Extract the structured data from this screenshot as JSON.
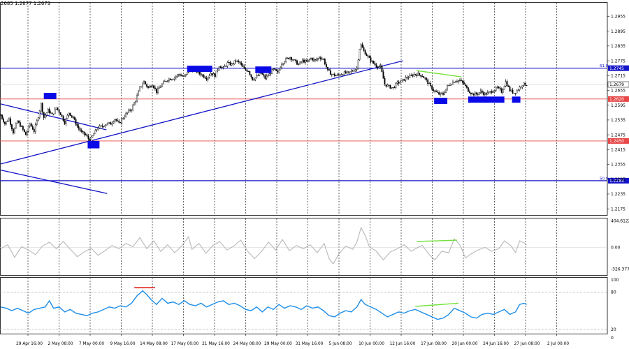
{
  "quote_line": "2685 1.2677 1.2679",
  "chart_data": [
    {
      "type": "candlestick",
      "panel": "price",
      "ylim": [
        1.215,
        1.301
      ],
      "y_ticks": [
        "1.2955",
        "1.2895",
        "1.2835",
        "1.2775",
        "1.2715",
        "1.2655",
        "1.2595",
        "1.2535",
        "1.2475",
        "1.2415",
        "1.2355",
        "1.2295",
        "1.2235",
        "1.2175"
      ],
      "current_price": "1.2679",
      "horizontal_levels": [
        {
          "label": "1.2745",
          "value": 1.2745,
          "fib_label": "61.8",
          "color": "#1414c8"
        },
        {
          "label": "1.2620",
          "value": 1.262,
          "fib_label": "",
          "color": "#e84848"
        },
        {
          "label": "1.2450",
          "value": 1.245,
          "fib_label": "",
          "color": "#e84848"
        },
        {
          "label": "1.2289",
          "value": 1.2289,
          "fib_label": "50.0",
          "color": "#1414c8"
        }
      ],
      "x_ticks": [
        "29 Apr 16:00",
        "2 May 08:00",
        "7 May 00:00",
        "9 May 16:00",
        "14 May 08:00",
        "17 May 00:00",
        "21 May 16:00",
        "24 May 08:00",
        "29 May 00:00",
        "31 May 16:00",
        "5 Jun 08:00",
        "10 Jun 00:00",
        "12 Jun 16:00",
        "17 Jun 08:00",
        "20 Jun 00:00",
        "24 Jun 16:00",
        "27 Jun 08:00",
        "2 Jul 00:00"
      ],
      "close_path": [
        [
          0,
          1.2555
        ],
        [
          6,
          1.252
        ],
        [
          12,
          1.254
        ],
        [
          18,
          1.2485
        ],
        [
          24,
          1.253
        ],
        [
          30,
          1.2505
        ],
        [
          36,
          1.2475
        ],
        [
          42,
          1.252
        ],
        [
          48,
          1.249
        ],
        [
          54,
          1.255
        ],
        [
          58,
          1.26
        ],
        [
          62,
          1.2545
        ],
        [
          68,
          1.2575
        ],
        [
          74,
          1.2555
        ],
        [
          80,
          1.2585
        ],
        [
          86,
          1.256
        ],
        [
          92,
          1.2525
        ],
        [
          98,
          1.2565
        ],
        [
          104,
          1.2545
        ],
        [
          110,
          1.251
        ],
        [
          116,
          1.2485
        ],
        [
          122,
          1.2475
        ],
        [
          128,
          1.245
        ],
        [
          134,
          1.248
        ],
        [
          140,
          1.2505
        ],
        [
          146,
          1.251
        ],
        [
          152,
          1.252
        ],
        [
          158,
          1.252
        ],
        [
          164,
          1.254
        ],
        [
          170,
          1.252
        ],
        [
          176,
          1.2545
        ],
        [
          182,
          1.2565
        ],
        [
          188,
          1.258
        ],
        [
          194,
          1.2615
        ],
        [
          200,
          1.2665
        ],
        [
          206,
          1.269
        ],
        [
          212,
          1.2665
        ],
        [
          218,
          1.268
        ],
        [
          224,
          1.265
        ],
        [
          232,
          1.268
        ],
        [
          240,
          1.27
        ],
        [
          248,
          1.2705
        ],
        [
          256,
          1.272
        ],
        [
          264,
          1.271
        ],
        [
          272,
          1.274
        ],
        [
          280,
          1.2735
        ],
        [
          288,
          1.272
        ],
        [
          296,
          1.2705
        ],
        [
          302,
          1.2725
        ],
        [
          308,
          1.2715
        ],
        [
          314,
          1.2755
        ],
        [
          320,
          1.2745
        ],
        [
          326,
          1.2765
        ],
        [
          332,
          1.276
        ],
        [
          338,
          1.2775
        ],
        [
          344,
          1.2765
        ],
        [
          350,
          1.274
        ],
        [
          356,
          1.2735
        ],
        [
          362,
          1.27
        ],
        [
          368,
          1.271
        ],
        [
          374,
          1.2725
        ],
        [
          380,
          1.2705
        ],
        [
          386,
          1.272
        ],
        [
          392,
          1.274
        ],
        [
          398,
          1.2725
        ],
        [
          404,
          1.2765
        ],
        [
          410,
          1.278
        ],
        [
          416,
          1.279
        ],
        [
          422,
          1.2775
        ],
        [
          428,
          1.276
        ],
        [
          434,
          1.2775
        ],
        [
          440,
          1.277
        ],
        [
          446,
          1.2785
        ],
        [
          452,
          1.2775
        ],
        [
          458,
          1.279
        ],
        [
          464,
          1.278
        ],
        [
          470,
          1.2735
        ],
        [
          476,
          1.272
        ],
        [
          482,
          1.2715
        ],
        [
          488,
          1.272
        ],
        [
          494,
          1.2725
        ],
        [
          500,
          1.2725
        ],
        [
          506,
          1.2735
        ],
        [
          512,
          1.2745
        ],
        [
          517,
          1.2845
        ],
        [
          522,
          1.2815
        ],
        [
          528,
          1.279
        ],
        [
          534,
          1.277
        ],
        [
          540,
          1.2755
        ],
        [
          546,
          1.275
        ],
        [
          552,
          1.268
        ],
        [
          558,
          1.267
        ],
        [
          564,
          1.2665
        ],
        [
          570,
          1.2685
        ],
        [
          576,
          1.269
        ],
        [
          582,
          1.2705
        ],
        [
          588,
          1.271
        ],
        [
          594,
          1.272
        ],
        [
          600,
          1.272
        ],
        [
          606,
          1.2715
        ],
        [
          612,
          1.2695
        ],
        [
          618,
          1.267
        ],
        [
          624,
          1.265
        ],
        [
          630,
          1.264
        ],
        [
          636,
          1.264
        ],
        [
          642,
          1.267
        ],
        [
          648,
          1.2685
        ],
        [
          654,
          1.2695
        ],
        [
          660,
          1.2695
        ],
        [
          666,
          1.268
        ],
        [
          672,
          1.2655
        ],
        [
          678,
          1.264
        ],
        [
          684,
          1.264
        ],
        [
          690,
          1.265
        ],
        [
          696,
          1.264
        ],
        [
          702,
          1.2645
        ],
        [
          708,
          1.2655
        ],
        [
          714,
          1.2665
        ],
        [
          720,
          1.265
        ],
        [
          726,
          1.269
        ],
        [
          732,
          1.2655
        ],
        [
          738,
          1.2645
        ],
        [
          744,
          1.266
        ],
        [
          750,
          1.268
        ],
        [
          756,
          1.2679
        ]
      ],
      "trend_lines": [
        {
          "from": [
            0,
            1.26
          ],
          "to": [
            152,
            1.2495
          ],
          "color": "#1414c8"
        },
        {
          "from": [
            0,
            1.2332
          ],
          "to": [
            153,
            1.2237
          ],
          "color": "#1414c8"
        },
        {
          "from": [
            0,
            1.2357
          ],
          "to": [
            578,
            1.2775
          ],
          "color": "#1414c8"
        }
      ],
      "divergence_line": {
        "from": [
          598,
          1.2735
        ],
        "to": [
          662,
          1.271
        ],
        "color": "#72e03a"
      },
      "zones": [
        {
          "x": [
            62,
            80
          ],
          "y": [
            1.262,
            1.2645
          ]
        },
        {
          "x": [
            125,
            142
          ],
          "y": [
            1.242,
            1.245
          ]
        },
        {
          "x": [
            268,
            304
          ],
          "y": [
            1.273,
            1.2755
          ]
        },
        {
          "x": [
            366,
            389
          ],
          "y": [
            1.2725,
            1.2752
          ]
        },
        {
          "x": [
            623,
            642
          ],
          "y": [
            1.26,
            1.2625
          ]
        },
        {
          "x": [
            672,
            724
          ],
          "y": [
            1.2605,
            1.263
          ]
        },
        {
          "x": [
            735,
            747
          ],
          "y": [
            1.2605,
            1.263
          ]
        }
      ]
    },
    {
      "type": "line",
      "panel": "cci",
      "ylim": [
        -420,
        440
      ],
      "y_ticks": [
        "404.6122",
        "0.00",
        "-326.377"
      ],
      "color": "#b8b8b8",
      "path": [
        [
          0,
          -20
        ],
        [
          10,
          40
        ],
        [
          20,
          -150
        ],
        [
          30,
          10
        ],
        [
          40,
          -40
        ],
        [
          50,
          -110
        ],
        [
          60,
          20
        ],
        [
          70,
          80
        ],
        [
          80,
          -20
        ],
        [
          90,
          90
        ],
        [
          100,
          -30
        ],
        [
          110,
          -140
        ],
        [
          120,
          -70
        ],
        [
          130,
          -10
        ],
        [
          140,
          -120
        ],
        [
          150,
          -50
        ],
        [
          160,
          30
        ],
        [
          170,
          -20
        ],
        [
          180,
          60
        ],
        [
          190,
          10
        ],
        [
          200,
          150
        ],
        [
          210,
          -20
        ],
        [
          220,
          100
        ],
        [
          230,
          -60
        ],
        [
          240,
          40
        ],
        [
          250,
          -80
        ],
        [
          260,
          20
        ],
        [
          270,
          160
        ],
        [
          275,
          -30
        ],
        [
          285,
          60
        ],
        [
          295,
          -90
        ],
        [
          305,
          30
        ],
        [
          315,
          90
        ],
        [
          325,
          -40
        ],
        [
          335,
          20
        ],
        [
          345,
          110
        ],
        [
          355,
          -60
        ],
        [
          365,
          -170
        ],
        [
          375,
          -60
        ],
        [
          385,
          80
        ],
        [
          395,
          -40
        ],
        [
          405,
          120
        ],
        [
          415,
          -50
        ],
        [
          425,
          30
        ],
        [
          435,
          -20
        ],
        [
          445,
          40
        ],
        [
          455,
          -80
        ],
        [
          465,
          60
        ],
        [
          472,
          -170
        ],
        [
          478,
          -250
        ],
        [
          486,
          -100
        ],
        [
          496,
          20
        ],
        [
          506,
          -30
        ],
        [
          512,
          80
        ],
        [
          518,
          300
        ],
        [
          524,
          180
        ],
        [
          530,
          10
        ],
        [
          540,
          -60
        ],
        [
          550,
          -190
        ],
        [
          560,
          -70
        ],
        [
          570,
          -20
        ],
        [
          580,
          40
        ],
        [
          590,
          -60
        ],
        [
          596,
          -20
        ],
        [
          606,
          30
        ],
        [
          616,
          -110
        ],
        [
          624,
          -190
        ],
        [
          634,
          -60
        ],
        [
          644,
          -80
        ],
        [
          652,
          130
        ],
        [
          660,
          40
        ],
        [
          668,
          -160
        ],
        [
          676,
          -100
        ],
        [
          686,
          -40
        ],
        [
          696,
          0
        ],
        [
          706,
          -60
        ],
        [
          716,
          -20
        ],
        [
          724,
          100
        ],
        [
          734,
          20
        ],
        [
          740,
          -80
        ],
        [
          746,
          100
        ],
        [
          752,
          70
        ],
        [
          756,
          40
        ]
      ],
      "divergence_line": {
        "from": [
          598,
          90
        ],
        "to": [
          656,
          110
        ],
        "color": "#72e03a"
      }
    },
    {
      "type": "line",
      "panel": "rsi",
      "ylim": [
        13,
        103
      ],
      "y_ticks": [
        "100",
        "80",
        "20",
        "0"
      ],
      "levels": [
        80,
        20
      ],
      "color": "#1e8ee8",
      "path": [
        [
          0,
          56
        ],
        [
          8,
          54
        ],
        [
          16,
          50
        ],
        [
          24,
          54
        ],
        [
          32,
          50
        ],
        [
          40,
          46
        ],
        [
          48,
          52
        ],
        [
          56,
          54
        ],
        [
          64,
          56
        ],
        [
          70,
          66
        ],
        [
          76,
          54
        ],
        [
          84,
          56
        ],
        [
          92,
          48
        ],
        [
          100,
          52
        ],
        [
          108,
          46
        ],
        [
          116,
          44
        ],
        [
          124,
          42
        ],
        [
          132,
          46
        ],
        [
          140,
          48
        ],
        [
          148,
          52
        ],
        [
          156,
          56
        ],
        [
          164,
          54
        ],
        [
          172,
          58
        ],
        [
          180,
          56
        ],
        [
          188,
          62
        ],
        [
          196,
          74
        ],
        [
          204,
          82
        ],
        [
          210,
          76
        ],
        [
          216,
          68
        ],
        [
          224,
          60
        ],
        [
          232,
          70
        ],
        [
          240,
          62
        ],
        [
          248,
          64
        ],
        [
          256,
          60
        ],
        [
          264,
          66
        ],
        [
          272,
          60
        ],
        [
          280,
          58
        ],
        [
          288,
          62
        ],
        [
          296,
          56
        ],
        [
          304,
          60
        ],
        [
          312,
          64
        ],
        [
          320,
          66
        ],
        [
          328,
          60
        ],
        [
          336,
          62
        ],
        [
          344,
          58
        ],
        [
          352,
          52
        ],
        [
          360,
          50
        ],
        [
          368,
          56
        ],
        [
          376,
          48
        ],
        [
          384,
          56
        ],
        [
          392,
          52
        ],
        [
          400,
          60
        ],
        [
          408,
          54
        ],
        [
          416,
          58
        ],
        [
          424,
          56
        ],
        [
          432,
          52
        ],
        [
          440,
          58
        ],
        [
          448,
          54
        ],
        [
          456,
          56
        ],
        [
          464,
          50
        ],
        [
          472,
          42
        ],
        [
          480,
          40
        ],
        [
          488,
          46
        ],
        [
          496,
          50
        ],
        [
          504,
          48
        ],
        [
          512,
          56
        ],
        [
          518,
          68
        ],
        [
          524,
          60
        ],
        [
          532,
          56
        ],
        [
          540,
          52
        ],
        [
          548,
          46
        ],
        [
          556,
          40
        ],
        [
          564,
          44
        ],
        [
          572,
          48
        ],
        [
          580,
          46
        ],
        [
          588,
          50
        ],
        [
          596,
          52
        ],
        [
          604,
          48
        ],
        [
          612,
          44
        ],
        [
          620,
          40
        ],
        [
          628,
          36
        ],
        [
          636,
          38
        ],
        [
          644,
          44
        ],
        [
          652,
          54
        ],
        [
          660,
          50
        ],
        [
          668,
          46
        ],
        [
          676,
          40
        ],
        [
          684,
          38
        ],
        [
          692,
          44
        ],
        [
          700,
          46
        ],
        [
          708,
          44
        ],
        [
          716,
          48
        ],
        [
          724,
          52
        ],
        [
          732,
          44
        ],
        [
          740,
          48
        ],
        [
          746,
          60
        ],
        [
          752,
          62
        ],
        [
          756,
          60
        ]
      ],
      "overbought_marker": {
        "from": [
          192,
          87
        ],
        "to": [
          222,
          87
        ],
        "color": "#e02020"
      },
      "divergence_line": {
        "from": [
          596,
          57
        ],
        "to": [
          658,
          62
        ],
        "color": "#72e03a"
      }
    }
  ]
}
